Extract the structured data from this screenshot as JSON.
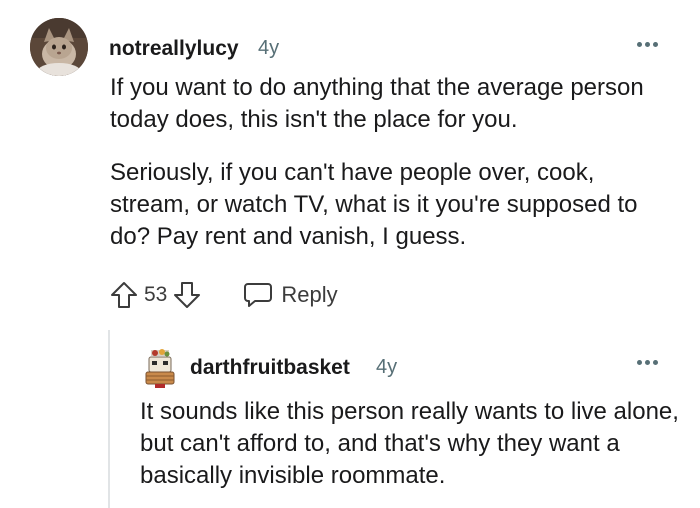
{
  "comment": {
    "username": "notreallylucy",
    "time": "4y",
    "paragraphs": [
      "If you want to do anything that the average person today does, this isn't the place for you.",
      "Seriously, if you can't have people over, cook, stream, or watch TV, what is it you're supposed to do? Pay rent and vanish, I guess."
    ],
    "score": "53",
    "reply_label": "Reply",
    "avatar_icon": "cat-avatar",
    "more_icon": "more-options-icon"
  },
  "reply": {
    "username": "darthfruitbasket",
    "time": "4y",
    "text": "It sounds like this person really wants to live alone, but can't afford to, and that's why they want a basically invisible roommate.",
    "avatar_icon": "fruit-basket-avatar",
    "more_icon": "more-options-icon"
  },
  "colors": {
    "text": "#1a1a1b",
    "meta": "#576f76",
    "action": "#3c3c3c",
    "thread_line": "#e1e4e6"
  }
}
